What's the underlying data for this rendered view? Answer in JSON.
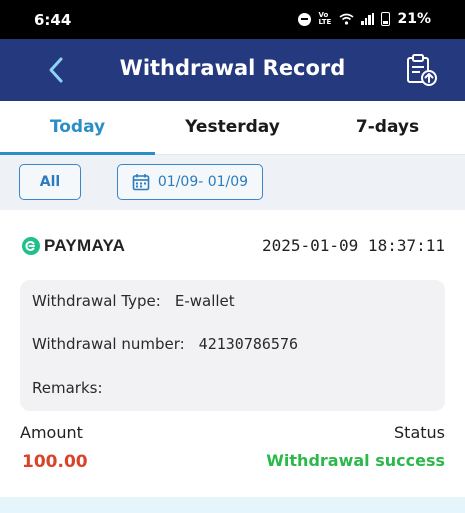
{
  "status_bar": {
    "time": "6:44",
    "network": "Vo LTE",
    "battery": "21%",
    "icons": [
      "dnd-icon",
      "volte-icon",
      "wifi-icon",
      "signal-icon",
      "battery-icon"
    ]
  },
  "header": {
    "title": "Withdrawal Record",
    "back_icon": "chevron-left-icon",
    "export_icon": "clipboard-upload-icon"
  },
  "tabs": [
    {
      "label": "Today",
      "active": true
    },
    {
      "label": "Yesterday",
      "active": false
    },
    {
      "label": "7-days",
      "active": false
    }
  ],
  "filter": {
    "all_label": "All",
    "date_range": "01/09- 01/09",
    "calendar_icon": "calendar-icon"
  },
  "record": {
    "provider": "PAYMAYA",
    "datetime": "2025-01-09 18:37:11",
    "type_label": "Withdrawal Type:",
    "type_value": "E-wallet",
    "number_label": "Withdrawal number:",
    "number_value": "42130786576",
    "remarks_label": "Remarks:",
    "amount_label": "Amount",
    "amount_value": "100.00",
    "status_label": "Status",
    "status_value": "Withdrawal success"
  },
  "colors": {
    "header_bg": "#24397e",
    "accent": "#2b8ec6",
    "amount": "#d9432a",
    "success": "#2cb84a",
    "paymaya_green": "#1fc08b"
  }
}
